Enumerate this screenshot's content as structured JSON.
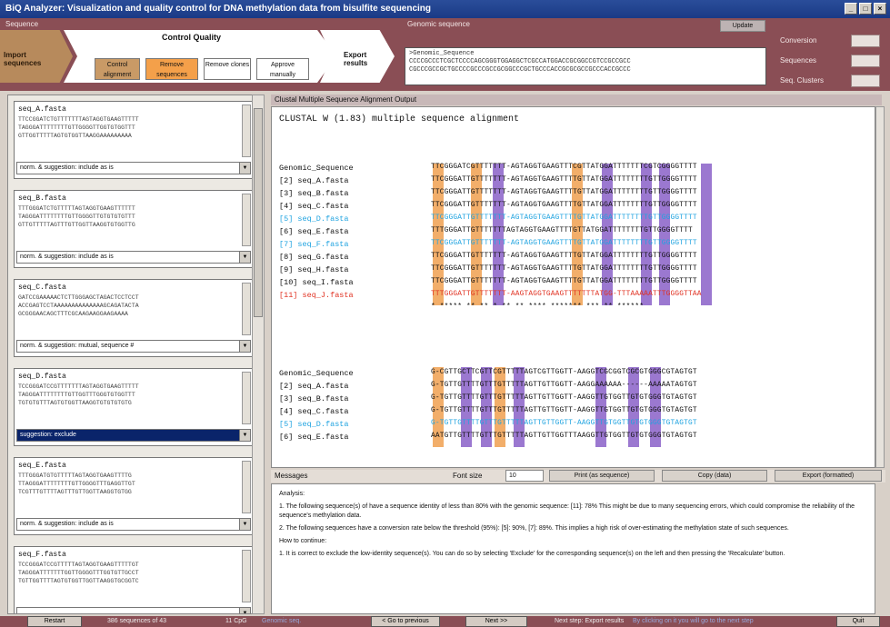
{
  "window": {
    "title": "BiQ Analyzer: Visualization and quality control for DNA methylation data from bisulfite sequencing",
    "controls": [
      "_",
      "□",
      "×"
    ]
  },
  "toolbar": {
    "sequence_label": "Sequence",
    "genomic_seq_label": "Genomic sequence",
    "update_label": "Update",
    "import_label": "Import sequences",
    "cq_label": "Control Quality",
    "sub": [
      "Control alignment",
      "Remove sequences",
      "Remove clones",
      "Approve manually"
    ],
    "export_label": "Export results",
    "genomic_seq_text": ">Genomic_Sequence\nCCCCGCCCTCGCTCCCCAGCGGGTGGAGGCTCGCCATGGACCGCGGCCGTCCGCCGCC\nCGCCCGCCGCTGCCCCGCCCGCCGCGGCCCGCTGCCCACCGCGCGCCGCCCACCGCCC",
    "right_labels": [
      "Conversion",
      "Sequences",
      "Seq. Clusters"
    ],
    "right_values": [
      "",
      "",
      ""
    ]
  },
  "left_cards": [
    {
      "name": "seq_A.fasta",
      "lines": [
        "TTCCGGATCTGTTTTTTTAGTAGGTGAAGTTTTT",
        "TAGGGATTTTTTTTGTTGGGGTTGGTGTGGTTT",
        "GTTGGTTTTTAGTGTGGTTAAGGAAAAAAAAA"
      ],
      "sel": "norm. & suggestion: include as is",
      "active": false
    },
    {
      "name": "seq_B.fasta",
      "lines": [
        "TTTGGGATCTGTTTTTAGTAGGTGAAGTTTTTT",
        "TAGGGATTTTTTTTGTTGGGGTTGTGTGTGTTT",
        "GTTGTTTTTAGTTTGTTGGTTAAGGTGTGGTTG"
      ],
      "sel": "norm. & suggestion: include as is",
      "active": false
    },
    {
      "name": "seq_C.fasta",
      "lines": [
        "GATCCGAAAAACTCTTGGGAGCTAGACTCCTCCT",
        "ACCGAGTCCTAAAAAAAAAAAAAAGCAGATACTA",
        "GCGGGAACAGCTTTCGCAAGAAGGAAGAAAA"
      ],
      "sel": "norm. & suggestion: mutual, sequence #",
      "active": false
    },
    {
      "name": "seq_D.fasta",
      "lines": [
        "TCCGGGATCCGTTTTTTTAGTAGGTGAAGTTTTT",
        "TAGGGATTTTTTTTGTTGGTTTGGGTGTGGTTT",
        "TGTGTGTTTAGTGTGGTTAAGGTGTGTGTGTG"
      ],
      "sel": "suggestion: exclude",
      "active": true
    },
    {
      "name": "seq_E.fasta",
      "lines": [
        "TTTGGGATGTGTTTTTAGTAGGTGAAGTTTTG",
        "TTAGGGATTTTTTTTGTTGGGGTTTGAGGTTGT",
        "TCGTTTGTTTTAGTTTGTTGGTTAAGGTGTGG"
      ],
      "sel": "norm. & suggestion: include as is",
      "active": false
    },
    {
      "name": "seq_F.fasta",
      "lines": [
        "TCCGGGATCCGTTTTTAGTAGGTGAAGTTTTTGT",
        "TAGGGATTTTTTTGGTTGGGGTTTGGTGTTGCCT",
        "TGTTGGTTTTAGTGTGGTTGGTTAAGGTGCGGTC"
      ],
      "sel": "",
      "active": false
    }
  ],
  "alignment": {
    "header": "Clustal Multiple Sequence Alignment Output",
    "title": "CLUSTAL W (1.83) multiple sequence alignment",
    "block1": [
      {
        "name": "Genomic_Sequence",
        "seq": "TTCGGGATCGTTTTTTT-AGTAGGTGAAGTTTCGTTATGGATTTTTTTCGTCGGGGTTTT",
        "color": "#111"
      },
      {
        "name": "[2] seq_A.fasta",
        "seq": "TTCGGGATTGTTTTTTT-AGTAGGTGAAGTTTTGTTATGGATTTTTTTTGTTGGGGTTTT",
        "color": "#111"
      },
      {
        "name": "[3] seq_B.fasta",
        "seq": "TTCGGGATTGTTTTTTT-AGTAGGTGAAGTTTTGTTATGGATTTTTTTTGTTGGGGTTTT",
        "color": "#111"
      },
      {
        "name": "[4] seq_C.fasta",
        "seq": "TTCGGGATTGTTTTTTT-AGTAGGTGAAGTTTTGTTATGGATTTTTTTTGTTGGGGTTTT",
        "color": "#111"
      },
      {
        "name": "[5] seq_D.fasta",
        "seq": "TTCGGGATTGTTTTTTT-AGTAGGTGAAGTTTTGTTATGGATTTTTTTTGTTGGGGTTTT",
        "color": "#1fa3e0"
      },
      {
        "name": "[6] seq_E.fasta",
        "seq": "TTTGGGATTGTTTTTTTAGTAGGTGAAGTTTTGTTATGGATTTTTTTTGTTGGGGTTTT",
        "color": "#111"
      },
      {
        "name": "[7] seq_F.fasta",
        "seq": "TTCGGGATTGTTTTTTT-AGTAGGTGAAGTTTTGTTATGGATTTTTTTTGTTGGGGTTTT",
        "color": "#1fa3e0"
      },
      {
        "name": "[8] seq_G.fasta",
        "seq": "TTCGGGATTGTTTTTTT-AGTAGGTGAAGTTTTGTTATGGATTTTTTTTGTTGGGGTTTT",
        "color": "#111"
      },
      {
        "name": "[9] seq_H.fasta",
        "seq": "TTCGGGATTGTTTTTTT-AGTAGGTGAAGTTTTGTTATGGATTTTTTTTGTTGGGGTTTT",
        "color": "#111"
      },
      {
        "name": "[10] seq_I.fasta",
        "seq": "TTCGGGATTGTTTTTTT-AGTAGGTGAAGTTTTGTTATGGATTTTTTTTGTTGGGGTTTT",
        "color": "#111"
      },
      {
        "name": "[11] seq_J.fasta",
        "seq": "TTTGGGATTGTTTTTTT-AAGTAGGTGAAGTTTTTTTATGG-TTTAAAAATTTGGGGTTAA",
        "color": "#e03020"
      }
    ],
    "consensus1": "*  *****  ** ** *  ** **  ****  ******* ***     ** ******",
    "block2": [
      {
        "name": "Genomic_Sequence",
        "seq": "G-CGTTGCTTCGTTCGTTTTTAGTCGTTGGTT-AAGGTCGCGGTCGCGTGGGCGTAGTGT",
        "color": "#111"
      },
      {
        "name": "[2] seq_A.fasta",
        "seq": "G-TGTTGTTTTGTTTGTTTTTAGTTGTTGGTT-AAGGAAAAAA------AAAAATAGTGT",
        "color": "#111"
      },
      {
        "name": "[3] seq_B.fasta",
        "seq": "G-TGTTGTTTTGTTTGTTTTTAGTTGTTGGTT-AAGGTTGTGGTTGTGTGGGTGTAGTGT",
        "color": "#111"
      },
      {
        "name": "[4] seq_C.fasta",
        "seq": "G-TGTTGTTTTGTTTGTTTTTAGTTGTTGGTT-AAGGTTGTGGTTGTGTGGGTGTAGTGT",
        "color": "#111"
      },
      {
        "name": "[5] seq_D.fasta",
        "seq": "G-TGTTGTTTTGTTTGTTTTTAGTTGTTGGTT-AAGGTTGTGGTTGTGTGGGTGTAGTGT",
        "color": "#1fa3e0"
      },
      {
        "name": "[6] seq_E.fasta",
        "seq": "AATGTTGTTTTGTTTGTTTTTAGTTGTTGGTTTAAGGTTGTGGTTGTGTGGGTGTAGTGT",
        "color": "#111"
      }
    ]
  },
  "messages": {
    "header": "Messages",
    "font_size_label": "Font size",
    "font_size_value": "10",
    "print_label": "Print (as sequence)",
    "copy_label": "Copy (data)",
    "export_label": "Export (formatted)",
    "paragraphs": [
      "Analysis:",
      "1. The following sequence(s) of have a sequence identity of less than 80% with the genomic sequence: [11]: 78% This might be due to many sequencing errors, which could compromise the reliability of the sequence's methylation data.",
      "2. The following sequences have a conversion rate below the threshold (95%): [5]: 90%, [7]: 89%. This implies a high risk of over-estimating the methylation state of such sequences.",
      "How to continue:",
      "1. It is correct to exclude the low-identity sequence(s). You can do so by selecting 'Exclude' for the corresponding sequence(s) on the left and then pressing the 'Recalculate' button."
    ]
  },
  "bottom": {
    "b1": "Restart",
    "status": "386 sequences of 43",
    "cpg": "11 CpG",
    "link1": "Genomic seq.",
    "prev": "< Go to previous",
    "next": "Next >>",
    "info": "Next step: Export results",
    "link2": "By clicking on it you will go to the next step",
    "quit": "Quit"
  }
}
